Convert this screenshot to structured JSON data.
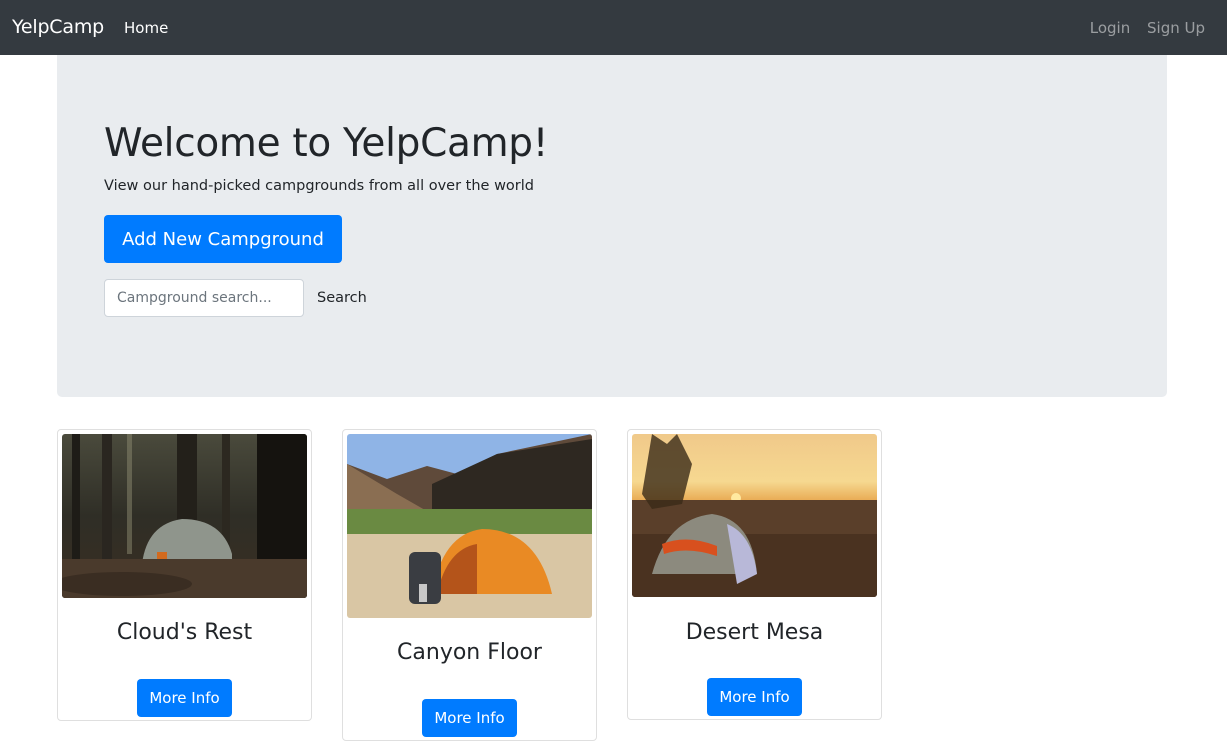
{
  "navbar": {
    "brand": "YelpCamp",
    "links": [
      {
        "label": "Home"
      }
    ],
    "right_links": [
      {
        "label": "Login"
      },
      {
        "label": "Sign Up"
      }
    ]
  },
  "jumbotron": {
    "title": "Welcome to YelpCamp!",
    "lead": "View our hand-picked campgrounds from all over the world",
    "add_button": "Add New Campground",
    "search": {
      "placeholder": "Campground search...",
      "value": "",
      "button": "Search"
    }
  },
  "campgrounds": [
    {
      "name": "Cloud's Rest",
      "image": "forest-tent-photo",
      "button": "More Info"
    },
    {
      "name": "Canyon Floor",
      "image": "canyon-orange-tent-photo",
      "button": "More Info"
    },
    {
      "name": "Desert Mesa",
      "image": "sunset-tent-photo",
      "button": "More Info"
    }
  ],
  "colors": {
    "navbar": "#343a40",
    "primary": "#007bff",
    "jumbotron": "#e9ecef"
  }
}
